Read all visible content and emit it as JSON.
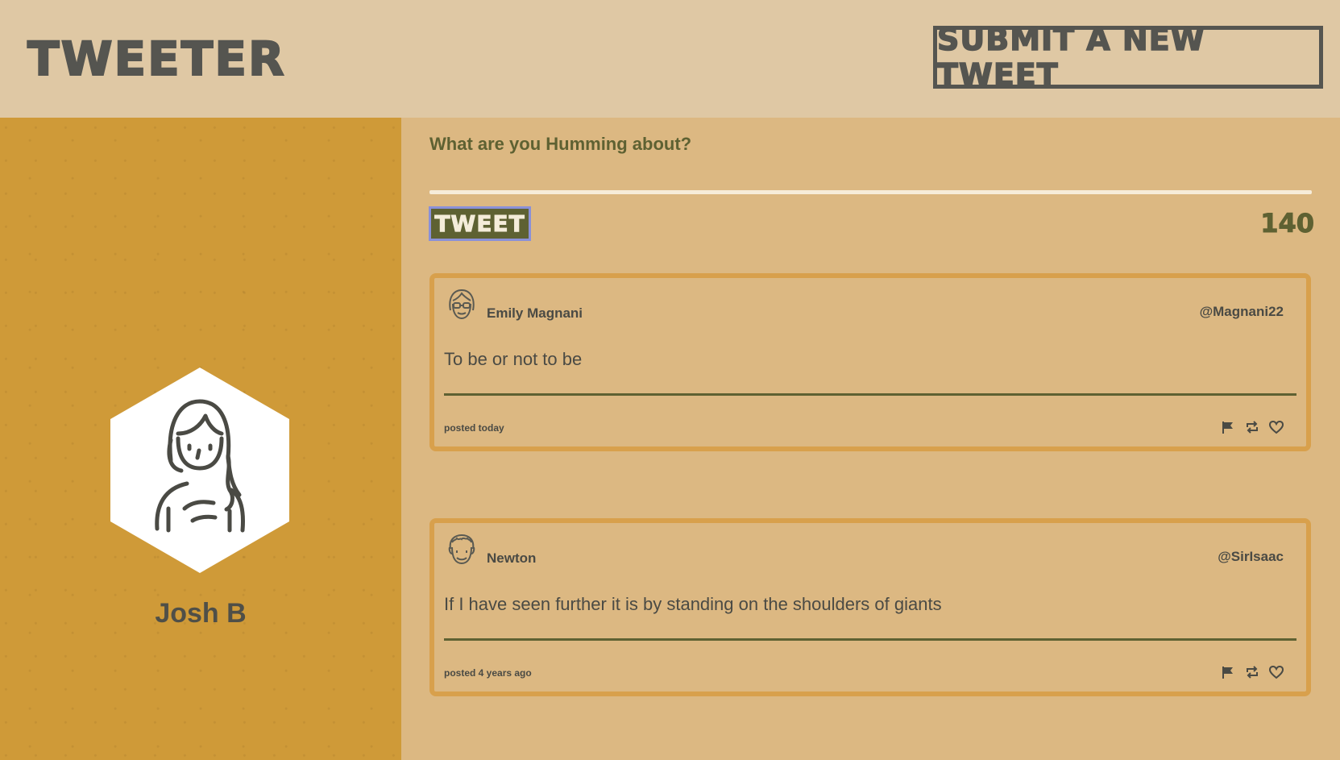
{
  "header": {
    "logo": "TWEETER",
    "submit_label": "SUBMIT A NEW TWEET"
  },
  "profile": {
    "name": "Josh B",
    "avatar_icon": "woman-avatar-icon"
  },
  "composer": {
    "prompt": "What are you Humming about?",
    "input_value": "",
    "button_label": "TWEET",
    "char_count": "140"
  },
  "tweets": [
    {
      "name": "Emily Magnani",
      "handle": "@Magnani22",
      "text": "To be or not to be",
      "time": "posted today",
      "avatar_icon": "woman-glasses-avatar-icon"
    },
    {
      "name": "Newton",
      "handle": "@SirIsaac",
      "text": "If I have seen further it is by standing on the shoulders of giants",
      "time": "posted 4 years ago",
      "avatar_icon": "man-curly-hair-avatar-icon"
    }
  ],
  "colors": {
    "header_bg": "#dfc8a4",
    "sidebar_bg": "#cf9a38",
    "main_bg": "#dcb882",
    "accent_olive": "#5e6132",
    "tweet_border": "#d8a04c",
    "dark_text": "#555550"
  }
}
